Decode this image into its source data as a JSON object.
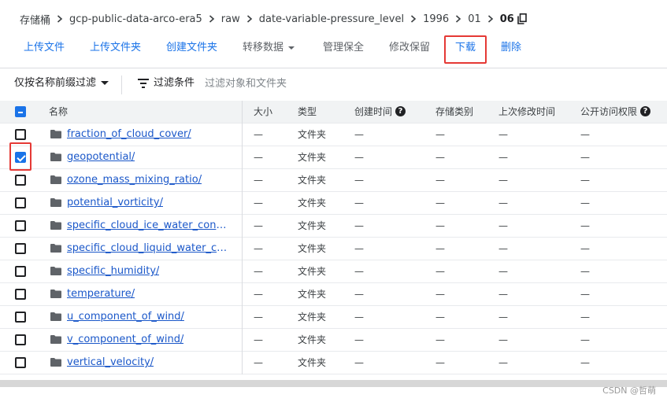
{
  "breadcrumb": {
    "items": [
      "存储桶",
      "gcp-public-data-arco-era5",
      "raw",
      "date-variable-pressure_level",
      "1996",
      "01"
    ],
    "current": "06"
  },
  "toolbar": {
    "upload_file": "上传文件",
    "upload_folder": "上传文件夹",
    "create_folder": "创建文件夹",
    "transfer_data": "转移数据",
    "manage_holds": "管理保全",
    "edit_retention": "修改保留",
    "download": "下载",
    "delete": "删除"
  },
  "filter": {
    "prefix_label": "仅按名称前缀过滤",
    "conditions_label": "过滤条件",
    "placeholder": "过滤对象和文件夹"
  },
  "table": {
    "headers": {
      "name": "名称",
      "size": "大小",
      "type": "类型",
      "created": "创建时间",
      "storage_class": "存储类别",
      "modified": "上次修改时间",
      "public_access": "公开访问权限"
    },
    "rows": [
      {
        "name": "fraction_of_cloud_cover/",
        "size": "—",
        "type": "文件夹",
        "created": "—",
        "storage_class": "—",
        "modified": "—",
        "public_access": "—",
        "checked": false
      },
      {
        "name": "geopotential/",
        "size": "—",
        "type": "文件夹",
        "created": "—",
        "storage_class": "—",
        "modified": "—",
        "public_access": "—",
        "checked": true
      },
      {
        "name": "ozone_mass_mixing_ratio/",
        "size": "—",
        "type": "文件夹",
        "created": "—",
        "storage_class": "—",
        "modified": "—",
        "public_access": "—",
        "checked": false
      },
      {
        "name": "potential_vorticity/",
        "size": "—",
        "type": "文件夹",
        "created": "—",
        "storage_class": "—",
        "modified": "—",
        "public_access": "—",
        "checked": false
      },
      {
        "name": "specific_cloud_ice_water_content/",
        "size": "—",
        "type": "文件夹",
        "created": "—",
        "storage_class": "—",
        "modified": "—",
        "public_access": "—",
        "checked": false
      },
      {
        "name": "specific_cloud_liquid_water_cont…",
        "size": "—",
        "type": "文件夹",
        "created": "—",
        "storage_class": "—",
        "modified": "—",
        "public_access": "—",
        "checked": false
      },
      {
        "name": "specific_humidity/",
        "size": "—",
        "type": "文件夹",
        "created": "—",
        "storage_class": "—",
        "modified": "—",
        "public_access": "—",
        "checked": false
      },
      {
        "name": "temperature/",
        "size": "—",
        "type": "文件夹",
        "created": "—",
        "storage_class": "—",
        "modified": "—",
        "public_access": "—",
        "checked": false
      },
      {
        "name": "u_component_of_wind/",
        "size": "—",
        "type": "文件夹",
        "created": "—",
        "storage_class": "—",
        "modified": "—",
        "public_access": "—",
        "checked": false
      },
      {
        "name": "v_component_of_wind/",
        "size": "—",
        "type": "文件夹",
        "created": "—",
        "storage_class": "—",
        "modified": "—",
        "public_access": "—",
        "checked": false
      },
      {
        "name": "vertical_velocity/",
        "size": "—",
        "type": "文件夹",
        "created": "—",
        "storage_class": "—",
        "modified": "—",
        "public_access": "—",
        "checked": false
      }
    ]
  },
  "watermark": "CSDN @哲萌",
  "icons": {
    "breadcrumb_sep": "chevron-right-icon",
    "copy": "copy-icon",
    "filter": "filter-list-icon",
    "folder": "folder-icon",
    "help": "help-icon"
  },
  "colors": {
    "accent": "#1a73e8",
    "link": "#1a57c9",
    "highlight_box": "#e53935",
    "selected_row": "#e8f0fe"
  }
}
